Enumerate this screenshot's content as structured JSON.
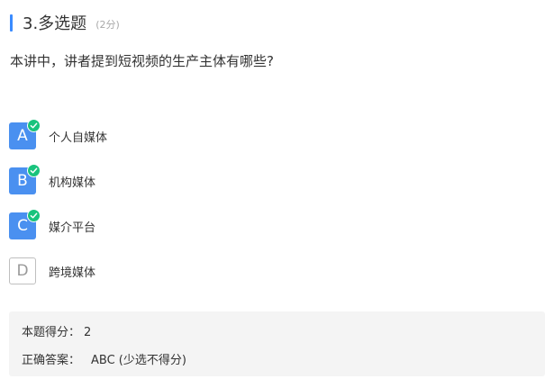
{
  "question": {
    "number_title": "3.多选题",
    "score_text": "(2分)",
    "stem": "本讲中，讲者提到短视频的生产主体有哪些?"
  },
  "options": [
    {
      "letter": "A",
      "text": "个人自媒体",
      "selected": true
    },
    {
      "letter": "B",
      "text": "机构媒体",
      "selected": true
    },
    {
      "letter": "C",
      "text": "媒介平台",
      "selected": true
    },
    {
      "letter": "D",
      "text": "跨境媒体",
      "selected": false
    }
  ],
  "result": {
    "score_label": "本题得分：",
    "score_value": "2",
    "answer_label": "正确答案：",
    "answer_value": "ABC (少选不得分)"
  },
  "colors": {
    "accent": "#3a8bff",
    "selected_letter_bg": "#4a90f0",
    "check_green": "#19c37d",
    "answer_bg": "#f4f4f4"
  },
  "icons": {
    "check": "check-circle-icon"
  }
}
